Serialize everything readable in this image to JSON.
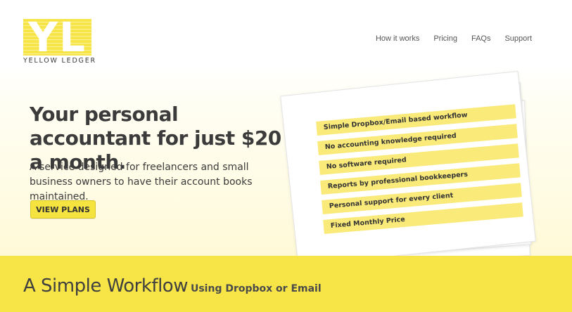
{
  "brand": {
    "logo_letters": "YL",
    "name": "YELLOW LEDGER",
    "accent_color": "#f7e547"
  },
  "nav": {
    "items": [
      {
        "label": "How it works"
      },
      {
        "label": "Pricing"
      },
      {
        "label": "FAQs"
      },
      {
        "label": "Support"
      }
    ]
  },
  "hero": {
    "headline": "Your personal accountant for just $20 a month.",
    "subtext": "A service designed for freelancers and small business owners to have their account books maintained.",
    "cta_label": "VIEW PLANS"
  },
  "features": [
    "Simple Dropbox/Email based workflow",
    "No accounting knowledge required",
    "No software required",
    "Reports by professional bookkeepers",
    "Personal support for every client",
    "Fixed Monthly Price"
  ],
  "workflow_section": {
    "title": "A Simple Workflow",
    "subtitle": "Using Dropbox or Email"
  }
}
